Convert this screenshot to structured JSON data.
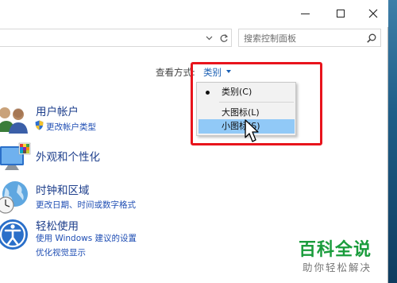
{
  "window": {
    "caption_buttons": [
      "minimize",
      "maximize",
      "close"
    ]
  },
  "address": {
    "search_placeholder": "搜索控制面板"
  },
  "view_by": {
    "label": "查看方式:",
    "value": "类别"
  },
  "view_menu": {
    "items": [
      {
        "label": "类别(C)",
        "selected": true
      },
      {
        "label": "大图标(L)",
        "selected": false
      },
      {
        "label": "小图标(S)",
        "selected": false,
        "hovered": true
      }
    ]
  },
  "categories": [
    {
      "title": "用户帐户",
      "links": [
        "更改帐户类型"
      ],
      "icon": "users-icon"
    },
    {
      "title": "外观和个性化",
      "links": [],
      "icon": "appearance-icon"
    },
    {
      "title": "时钟和区域",
      "links": [
        "更改日期、时间或数字格式"
      ],
      "icon": "clock-globe-icon"
    },
    {
      "title": "轻松使用",
      "links": [
        "使用 Windows 建议的设置",
        "优化视觉显示"
      ],
      "icon": "ease-of-access-icon"
    }
  ],
  "watermark": {
    "title": "百科全说",
    "subtitle": "助你轻松解决"
  },
  "colors": {
    "highlight": "#e8141c",
    "link": "#1e4db3",
    "menu_hover": "#91c9f7",
    "watermark": "#1a9c3c"
  }
}
